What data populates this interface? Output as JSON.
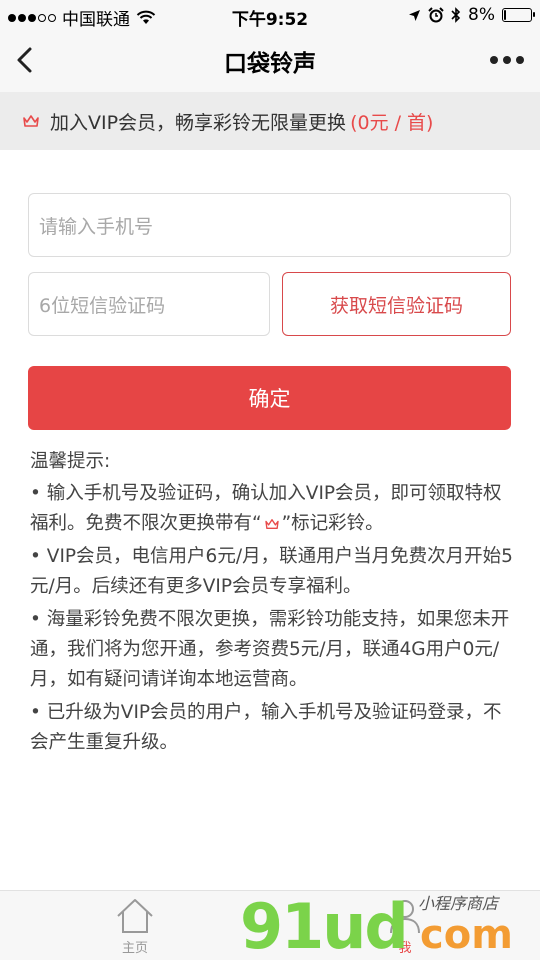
{
  "status": {
    "carrier": "中国联通",
    "time": "下午9:52",
    "battery": "8%",
    "battery_level": 0.08
  },
  "nav": {
    "title": "口袋铃声"
  },
  "vip": {
    "text": "加入VIP会员，畅享彩铃无限量更换",
    "price": "(0元 / 首)"
  },
  "form": {
    "phone_placeholder": "请输入手机号",
    "code_placeholder": "6位短信验证码",
    "get_code_label": "获取短信验证码",
    "confirm_label": "确定"
  },
  "tips": {
    "heading": "温馨提示:",
    "item1_a": "• 输入手机号及验证码，确认加入VIP会员，即可领取特权福利。免费不限次更换带有“",
    "item1_b": "”标记彩铃。",
    "item2": "• VIP会员，电信用户6元/月，联通用户当月免费次月开始5元/月。后续还有更多VIP会员专享福利。",
    "item3": "• 海量彩铃免费不限次更换，需彩铃功能支持，如果您未开通，我们将为您开通，参考资费5元/月，联通4G用户0元/月，如有疑问请详询本地运营商。",
    "item4": "• 已升级为VIP会员的用户，输入手机号及验证码登录，不会产生重复升级。"
  },
  "tabbar": {
    "home": "主页",
    "mine": "我"
  },
  "watermark": {
    "digits": "91ud",
    "com": "com",
    "small": "小程序商店"
  },
  "colors": {
    "accent": "#e64545",
    "vip_price": "#e84a4a"
  }
}
